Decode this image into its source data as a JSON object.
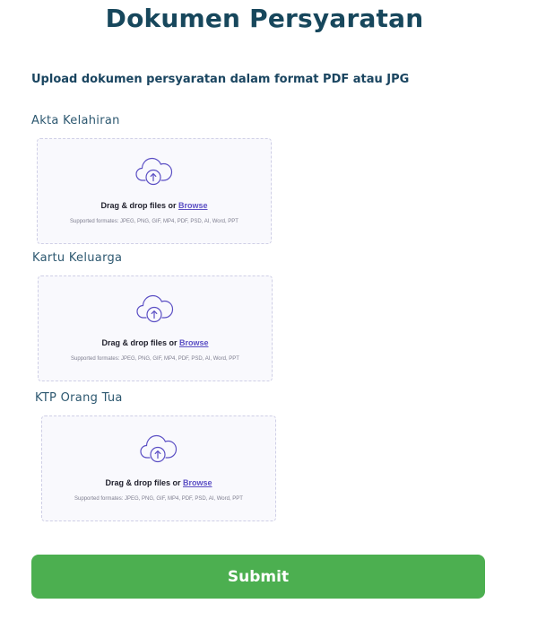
{
  "page": {
    "title": "Dokumen Persyaratan",
    "instruction": "Upload dokumen persyaratan dalam format PDF atau JPG"
  },
  "upload_fields": [
    {
      "label": "Akta Kelahiran",
      "drop_text": "Drag & drop files or ",
      "browse_text": "Browse",
      "formats_text": "Supported formates: JPEG, PNG, GIF, MP4, PDF, PSD, AI, Word, PPT",
      "icon": "cloud-upload-icon"
    },
    {
      "label": "Kartu Keluarga",
      "drop_text": "Drag & drop files or ",
      "browse_text": "Browse",
      "formats_text": "Supported formates: JPEG, PNG, GIF, MP4, PDF, PSD, AI, Word, PPT",
      "icon": "cloud-upload-icon"
    },
    {
      "label": "KTP Orang Tua",
      "drop_text": "Drag & drop files or ",
      "browse_text": "Browse",
      "formats_text": "Supported formates: JPEG, PNG, GIF, MP4, PDF, PSD, AI, Word, PPT",
      "icon": "cloud-upload-icon"
    }
  ],
  "submit": {
    "label": "Submit"
  },
  "colors": {
    "title": "#17475c",
    "browse_link": "#5b4fc4",
    "submit_bg": "#4caf50",
    "dropzone_border": "#cfcfe6"
  }
}
